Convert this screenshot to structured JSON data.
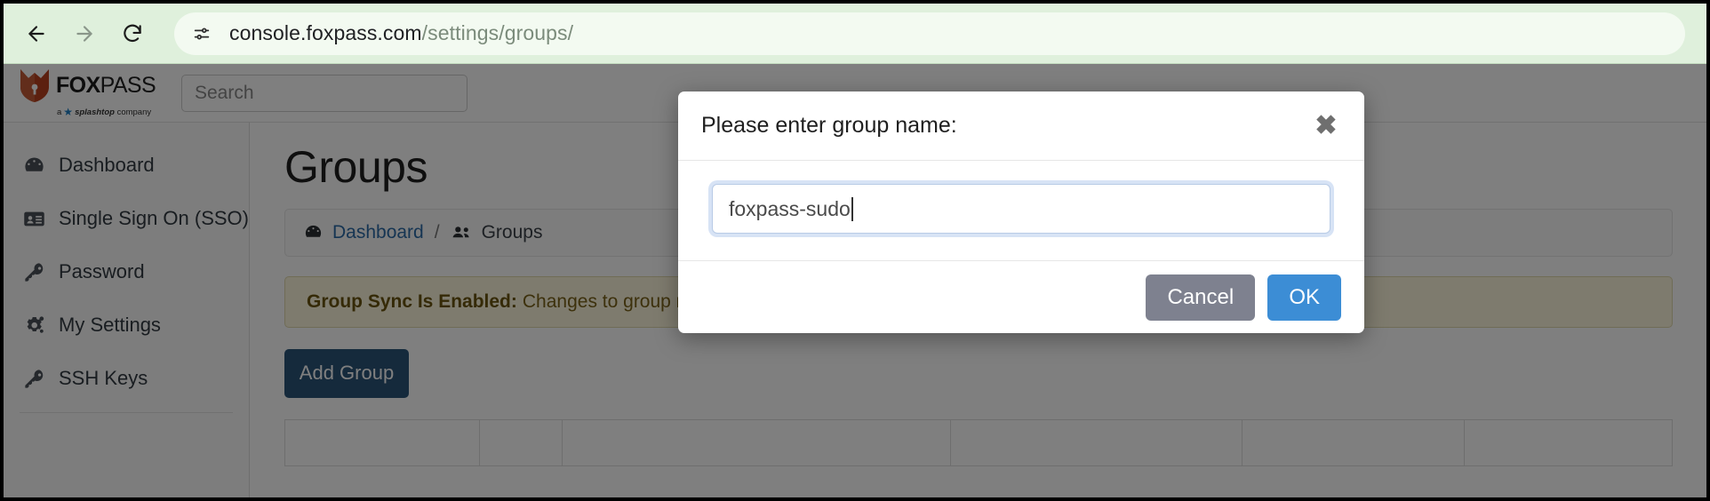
{
  "browser": {
    "back_icon": "arrow-left-icon",
    "forward_icon": "arrow-right-icon",
    "reload_icon": "reload-icon",
    "site_settings_icon": "page-settings-icon",
    "url_host": "console.foxpass.com",
    "url_path": "/settings/groups/"
  },
  "app": {
    "logo_name": "FOX",
    "logo_name_light": "PASS",
    "logo_sub_prefix": "a",
    "logo_sub_company": "splashtop",
    "logo_sub_suffix": "company",
    "search_placeholder": "Search"
  },
  "sidebar": {
    "items": [
      {
        "label": "Dashboard",
        "icon": "speedometer-icon"
      },
      {
        "label": "Single Sign On (SSO)",
        "icon": "id-card-icon"
      },
      {
        "label": "Password",
        "icon": "key-icon"
      },
      {
        "label": "My Settings",
        "icon": "gears-icon"
      },
      {
        "label": "SSH Keys",
        "icon": "key-icon"
      }
    ]
  },
  "main": {
    "page_title": "Groups",
    "breadcrumb": {
      "home_label": "Dashboard",
      "home_icon": "speedometer-icon",
      "separator": "/",
      "current_label": "Groups",
      "current_icon": "users-icon"
    },
    "alert": {
      "strong": "Group Sync Is Enabled:",
      "text": "Changes to group membe"
    },
    "add_group_label": "Add Group",
    "table": {
      "columns": [
        "",
        "",
        "",
        "",
        "",
        ""
      ]
    }
  },
  "modal": {
    "title": "Please enter group name:",
    "close_icon": "close-icon",
    "input_value": "foxpass-sudo",
    "input_placeholder": "",
    "cancel_label": "Cancel",
    "ok_label": "OK"
  },
  "colors": {
    "browser_bar": "#dff0dc",
    "primary_button": "#2b5579",
    "ok_button": "#3c8dd5",
    "cancel_button": "#7e818f",
    "link": "#2c6ba6",
    "alert_bg": "#fcf6dd",
    "logo_orange": "#b8411f"
  }
}
